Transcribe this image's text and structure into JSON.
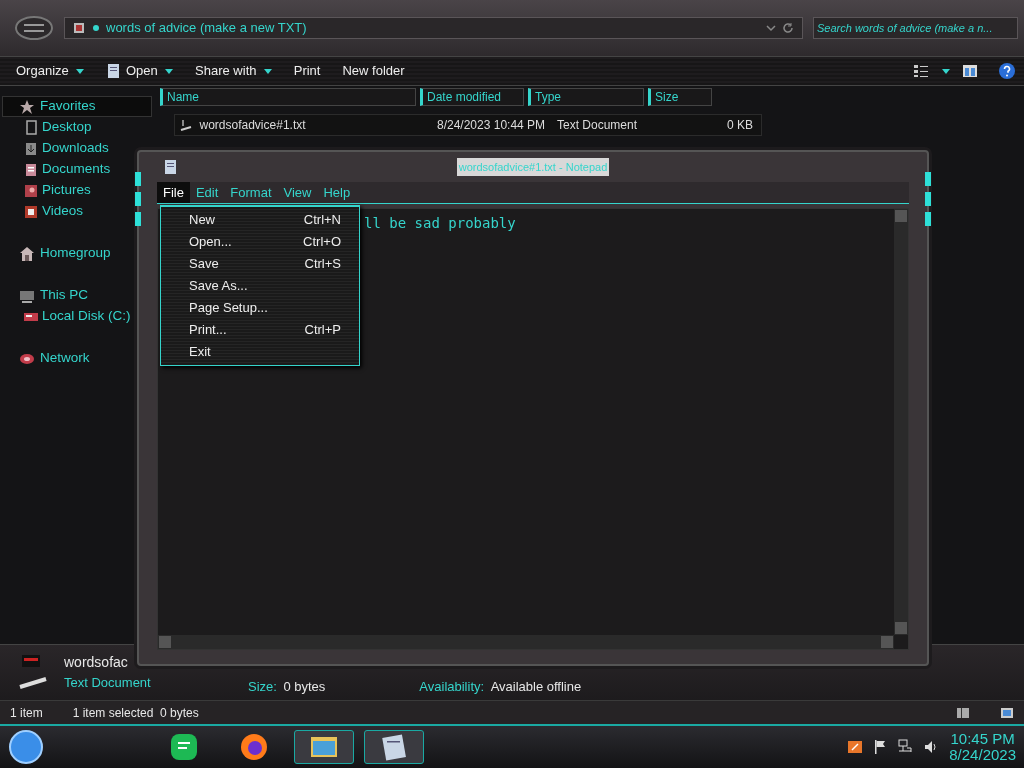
{
  "explorer": {
    "address": "words of advice (make a new TXT)",
    "search": {
      "placeholder": "Search words of advice (make a n..."
    },
    "toolbar": [
      {
        "label": "Organize",
        "dropdown": true
      },
      {
        "label": "Open",
        "dropdown": true,
        "kind": "open"
      },
      {
        "label": "Share with",
        "dropdown": true
      },
      {
        "label": "Print",
        "dropdown": false
      },
      {
        "label": "New folder",
        "dropdown": false
      }
    ],
    "sidebar": [
      {
        "label": "Favorites",
        "kind": "star",
        "selected": true,
        "children": [
          {
            "label": "Desktop",
            "kind": "monitor",
            "selected": false
          },
          {
            "label": "Downloads",
            "kind": "download",
            "selected": false
          },
          {
            "label": "Documents",
            "kind": "document",
            "selected": false
          },
          {
            "label": "Pictures",
            "kind": "image",
            "selected": false
          },
          {
            "label": "Videos",
            "kind": "film",
            "selected": false
          }
        ]
      },
      {
        "label": "Homegroup",
        "kind": "house",
        "selected": false
      },
      {
        "label": "This PC",
        "kind": "computer",
        "selected": false,
        "children": [
          {
            "label": "Local Disk (C:)",
            "kind": "drive",
            "selected": false
          }
        ]
      },
      {
        "label": "Network",
        "kind": "globe",
        "selected": false
      }
    ],
    "columns": [
      "Name",
      "Date modified",
      "Type",
      "Size"
    ],
    "rows": [
      {
        "name": "wordsofadvice#1.txt",
        "date": "8/24/2023 10:44 PM",
        "type": "Text Document",
        "size": "0 KB"
      }
    ],
    "details": {
      "name": "wordsofac",
      "type": "Text Document",
      "fields": [
        {
          "label": "Size:",
          "value": "0 bytes"
        },
        {
          "label": "Availability:",
          "value": "Available offline"
        }
      ]
    },
    "status_bar": {
      "count": "1 item",
      "selection": "1 item selected  0 bytes"
    }
  },
  "notepad": {
    "title": "wordsofadvice#1.txt - Notepad",
    "menu": [
      {
        "label": "File",
        "selected": true
      },
      {
        "label": "Edit",
        "selected": false
      },
      {
        "label": "Format",
        "selected": false
      },
      {
        "label": "View",
        "selected": false
      },
      {
        "label": "Help",
        "selected": false
      }
    ],
    "text": "ll be sad probably",
    "file_menu": [
      {
        "label": "New",
        "shortcut": "Ctrl+N"
      },
      {
        "label": "Open...",
        "shortcut": "Ctrl+O"
      },
      {
        "label": "Save",
        "shortcut": "Ctrl+S"
      },
      {
        "label": "Save As..."
      },
      {
        "label": "Page Setup..."
      },
      {
        "label": "Print...",
        "shortcut": "Ctrl+P"
      },
      {
        "label": "Exit"
      }
    ]
  },
  "taskbar": {
    "apps": [
      {
        "kind": "chat",
        "running": false
      },
      {
        "kind": "browser",
        "running": false
      },
      {
        "kind": "folder",
        "running": true
      },
      {
        "kind": "notepad",
        "running": true
      }
    ],
    "time": "10:45 PM",
    "date": "8/24/2023"
  }
}
